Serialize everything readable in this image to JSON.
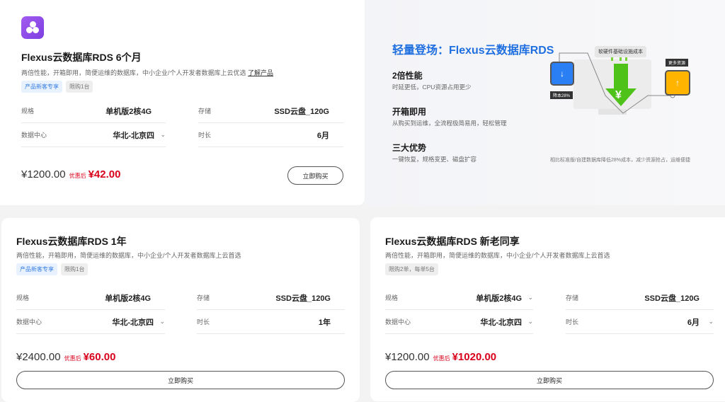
{
  "cards": [
    {
      "title": "Flexus云数据库RDS 6个月",
      "desc": "两倍性能，开箱即用，简便运维的数据库，中小企业/个人开发者数据库上云优选",
      "link": "了解产品",
      "tags": [
        "产品新客专享",
        "限购1台"
      ],
      "spec_label": "规格",
      "spec": "单机版2核4G",
      "storage_label": "存储",
      "storage": "SSD云盘_120G",
      "dc_label": "数据中心",
      "dc": "华北-北京四",
      "dur_label": "时长",
      "dur": "6月",
      "orig": "¥1200.00",
      "after": "优惠后",
      "now": "¥42.00",
      "buy": "立即购买"
    },
    {
      "title": "Flexus云数据库RDS 1年",
      "desc": "两倍性能，开箱即用，简便运维的数据库，中小企业/个人开发者数据库上云首选",
      "tags": [
        "产品新客专享",
        "限购1台"
      ],
      "spec_label": "规格",
      "spec": "单机版2核4G",
      "storage_label": "存储",
      "storage": "SSD云盘_120G",
      "dc_label": "数据中心",
      "dc": "华北-北京四",
      "dur_label": "时长",
      "dur": "1年",
      "orig": "¥2400.00",
      "after": "优惠后",
      "now": "¥60.00",
      "buy": "立即购买"
    },
    {
      "title": "Flexus云数据库RDS 新老同享",
      "desc": "两倍性能，开箱即用，简便运维的数据库，中小企业/个人开发者数据库上云首选",
      "tags": [
        "限购2单，每单5台"
      ],
      "spec_label": "规格",
      "spec": "单机版2核4G",
      "storage_label": "存储",
      "storage": "SSD云盘_120G",
      "dc_label": "数据中心",
      "dc": "华北-北京四",
      "dur_label": "时长",
      "dur": "6月",
      "orig": "¥1200.00",
      "after": "优惠后",
      "now": "¥1020.00",
      "buy": "立即购买"
    }
  ],
  "promo": {
    "title": "轻量登场：Flexus云数据库RDS",
    "features": [
      {
        "h": "2倍性能",
        "p": "时延更低，CPU资源占用更少"
      },
      {
        "h": "开箱即用",
        "p": "从购买到运维，全流程极简易用，轻松管理"
      },
      {
        "h": "三大优势",
        "p": "一键恢复，规格变更、磁盘扩容"
      }
    ],
    "bubble": "软硬件基础设施成本",
    "more": "更多资源",
    "down": "降本28%",
    "yen": "¥",
    "caption": "相比标准版/自建数据库降低28%成本，减少资源抢占，运维便捷"
  },
  "colors": {
    "accent": "#1f6fe0",
    "price": "#d9001b",
    "green": "#52c41a",
    "orange": "#ffb400"
  }
}
